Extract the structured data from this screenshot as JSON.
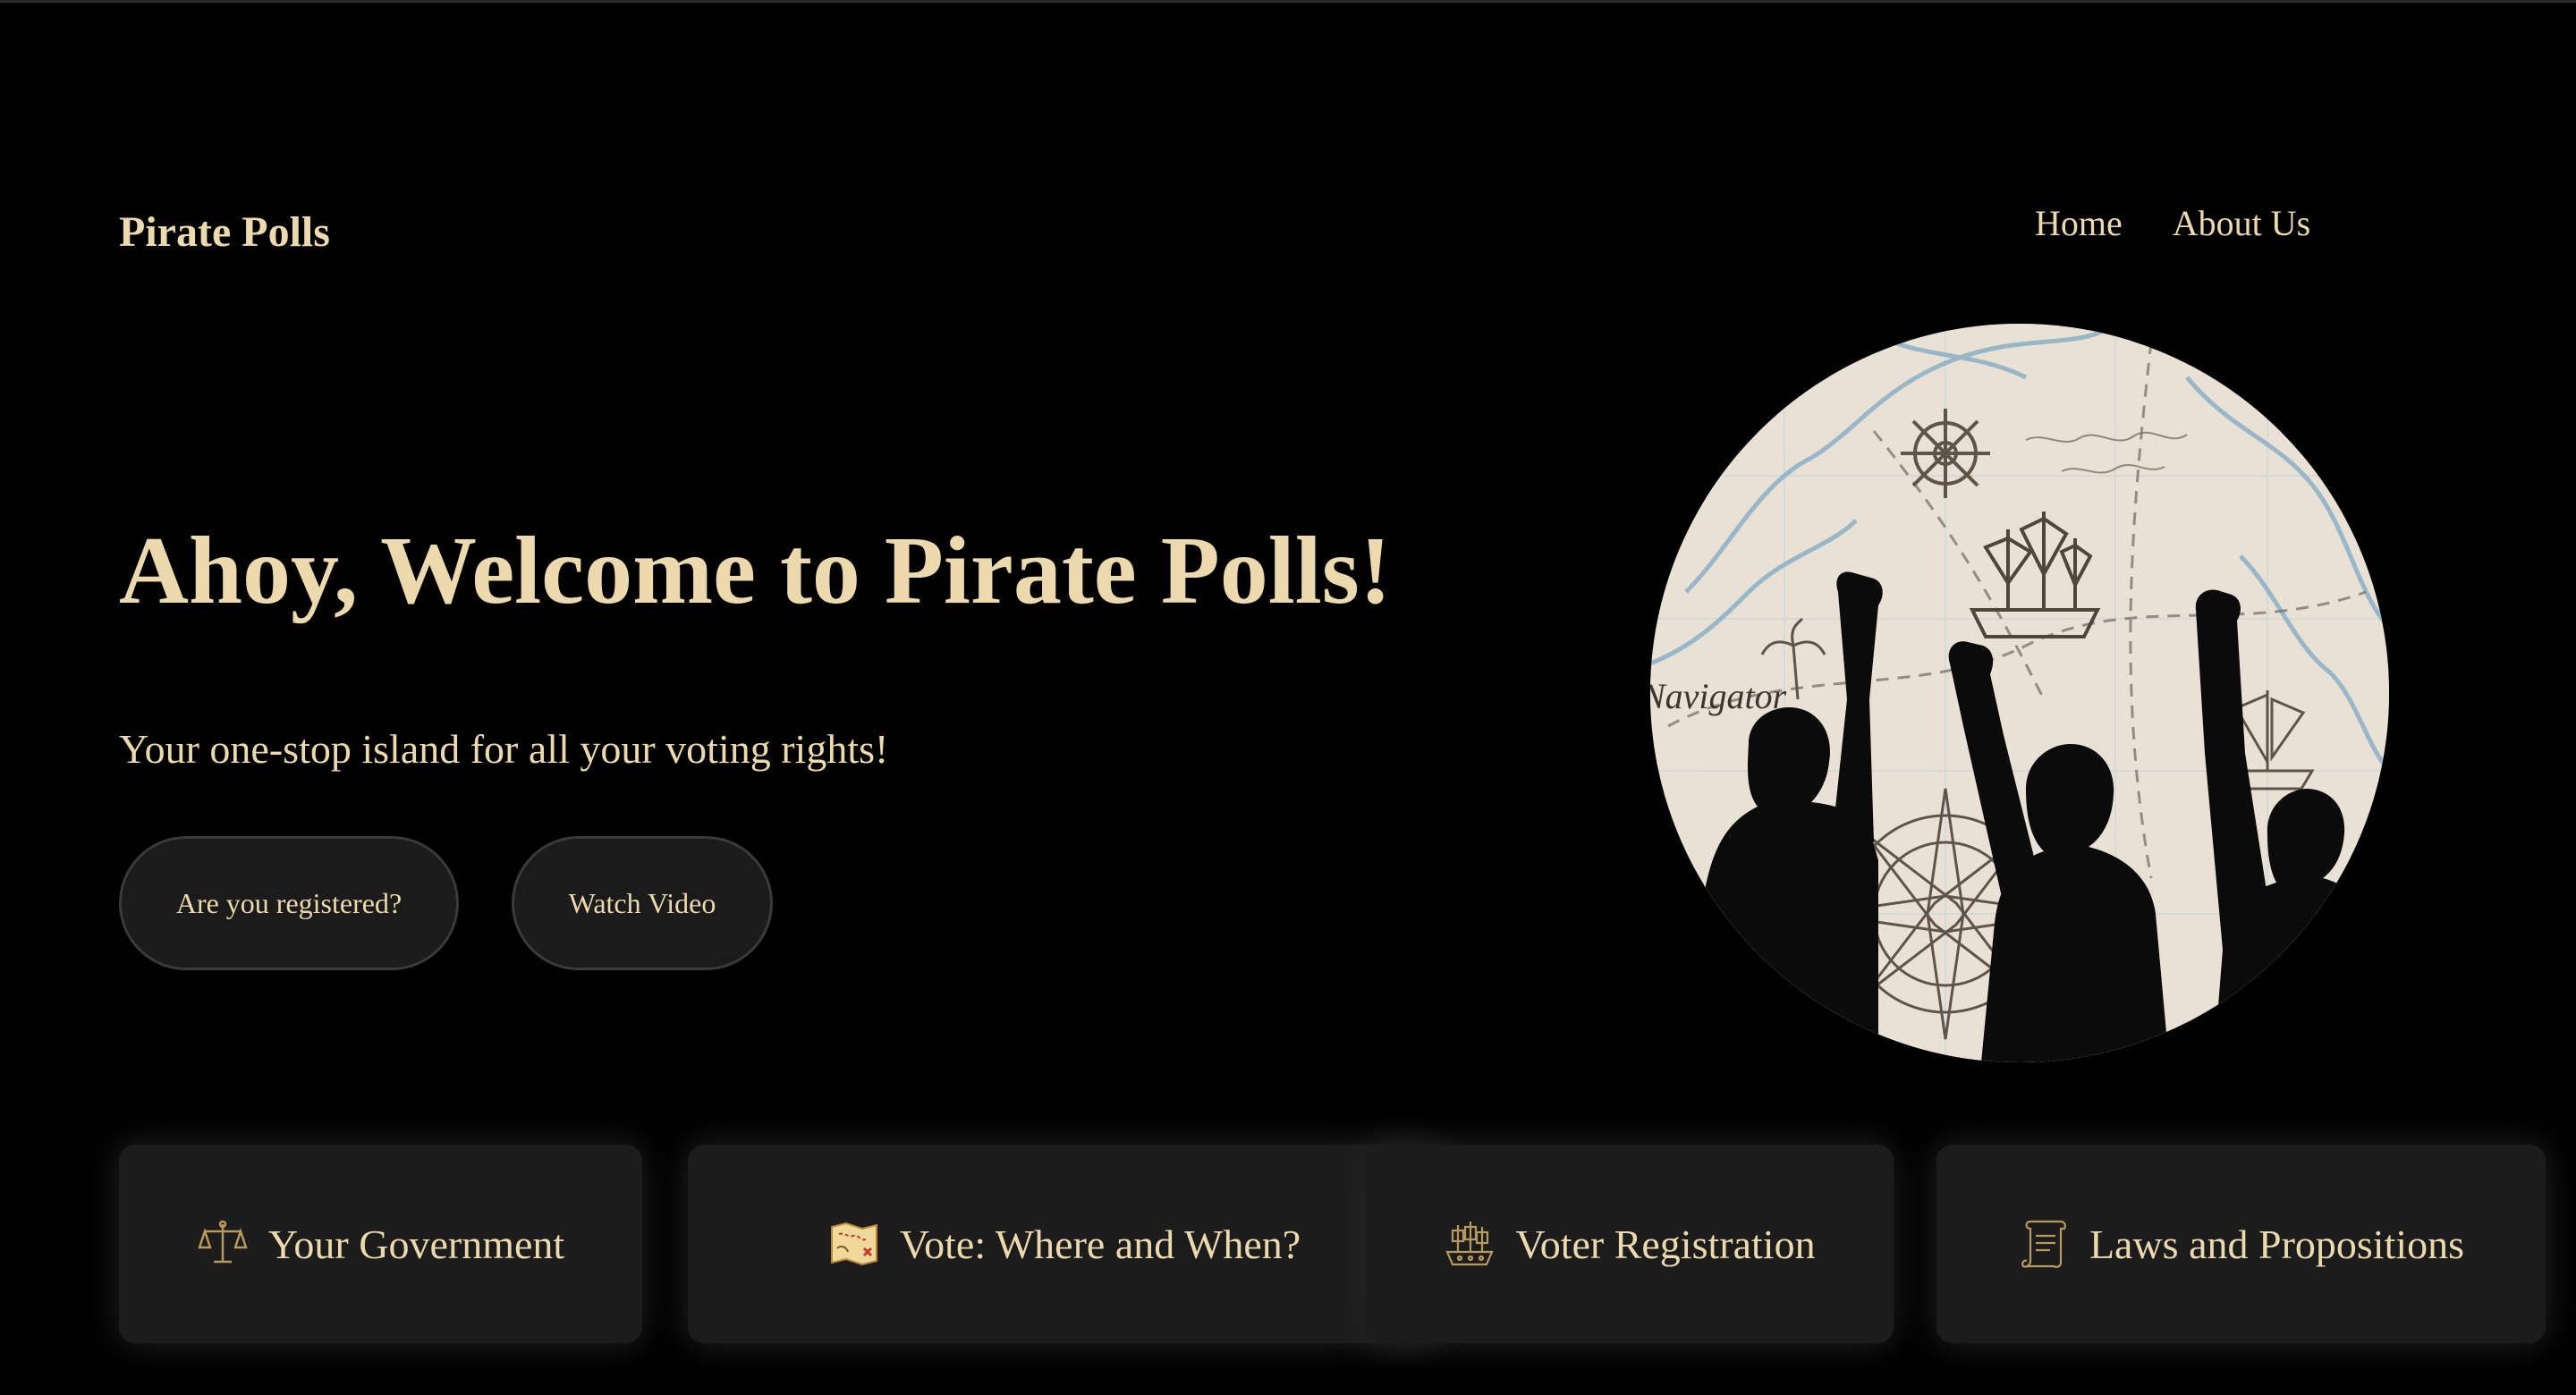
{
  "header": {
    "brand": "Pirate Polls",
    "nav": [
      {
        "label": "Home"
      },
      {
        "label": "About Us"
      }
    ]
  },
  "hero": {
    "title": "Ahoy, Welcome to Pirate Polls!",
    "subtitle": "Your one-stop island for all your voting rights!",
    "buttons": {
      "registered": "Are you registered?",
      "video": "Watch Video"
    },
    "image_text": "Navigator"
  },
  "cards": [
    {
      "label": "Your Government",
      "icon": "scales-icon"
    },
    {
      "label": "Vote: Where and When?",
      "icon": "treasure-map-icon"
    },
    {
      "label": "Voter Registration",
      "icon": "pirate-ship-icon"
    },
    {
      "label": "Laws and Propositions",
      "icon": "scroll-icon"
    }
  ],
  "colors": {
    "background": "#000000",
    "text": "#ecd9ad",
    "card": "#1c1c1c",
    "button": "#1b1b1b"
  }
}
